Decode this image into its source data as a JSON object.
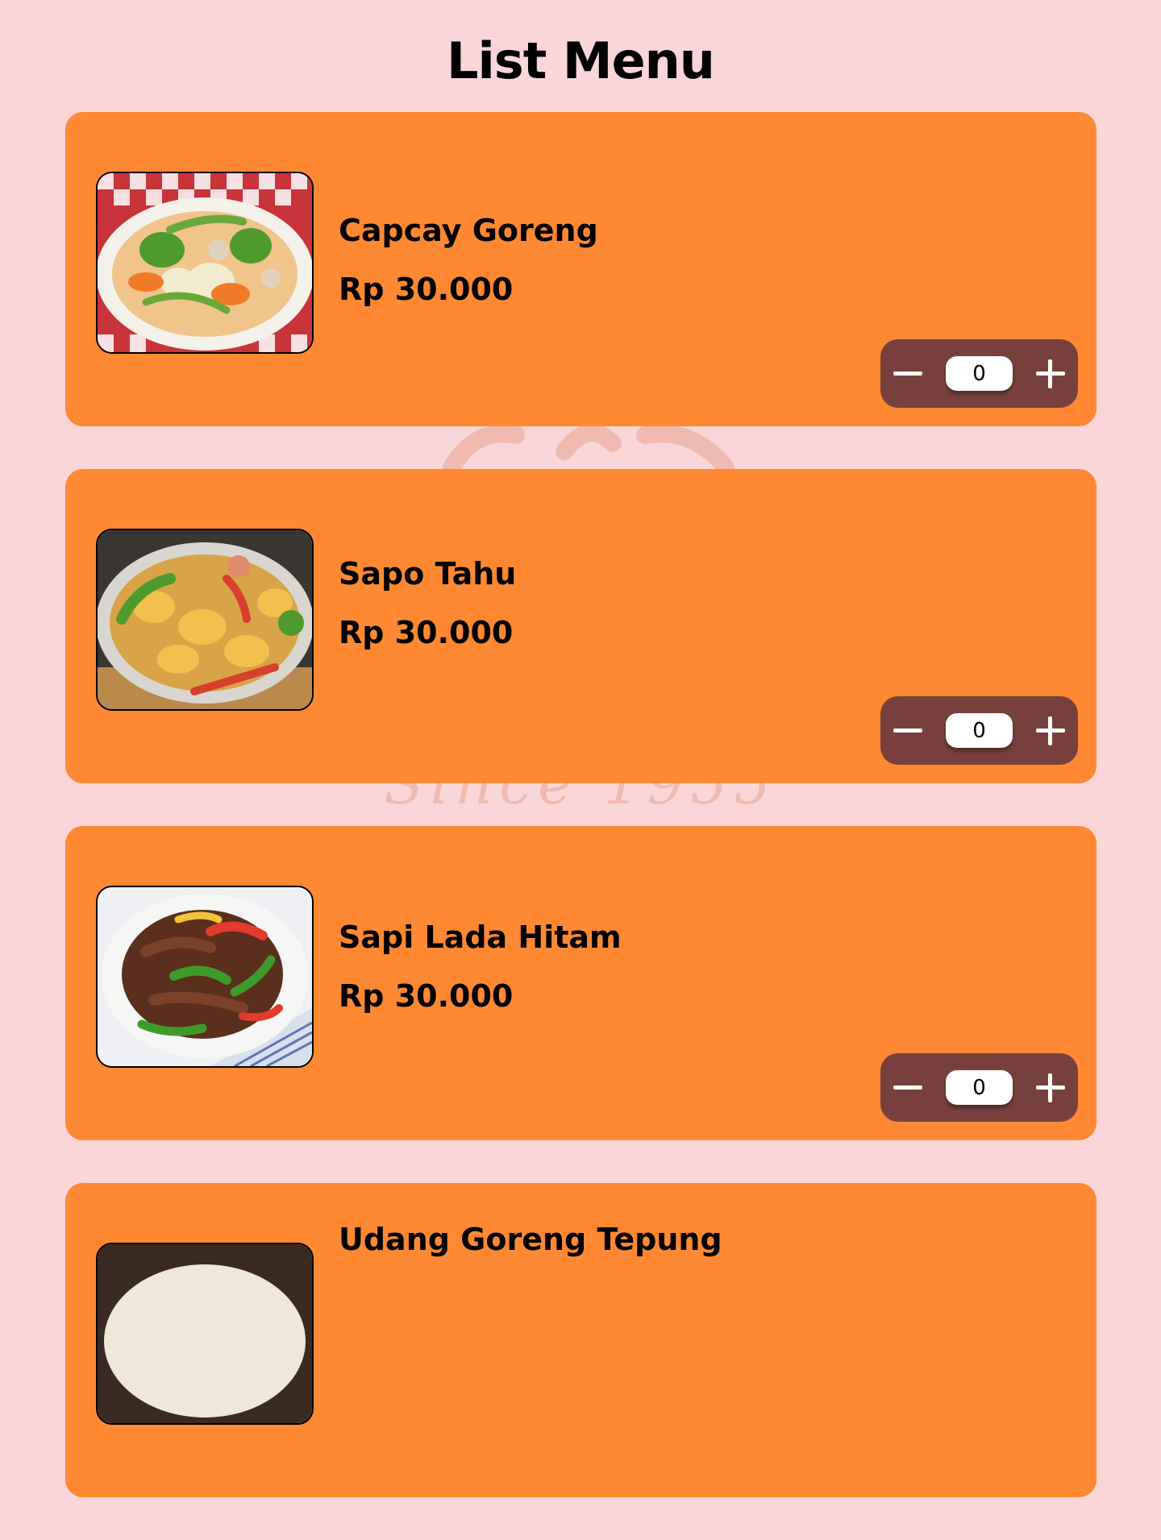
{
  "page": {
    "title": "List Menu",
    "watermark_text": "Since 1955"
  },
  "menu_items": [
    {
      "name": "Capcay Goreng",
      "price": "Rp 30.000",
      "quantity": "0",
      "image_icon": "capcay-goreng-dish-photo"
    },
    {
      "name": "Sapo Tahu",
      "price": "Rp 30.000",
      "quantity": "0",
      "image_icon": "sapo-tahu-dish-photo"
    },
    {
      "name": "Sapi Lada Hitam",
      "price": "Rp 30.000",
      "quantity": "0",
      "image_icon": "sapi-lada-hitam-dish-photo"
    },
    {
      "name": "Udang Goreng Tepung",
      "price": "",
      "quantity": "",
      "image_icon": "udang-goreng-tepung-dish-photo"
    }
  ],
  "colors": {
    "background": "#fad6d8",
    "card": "#ff8833",
    "qty_control": "#77403d",
    "qty_input": "#ffffff"
  }
}
